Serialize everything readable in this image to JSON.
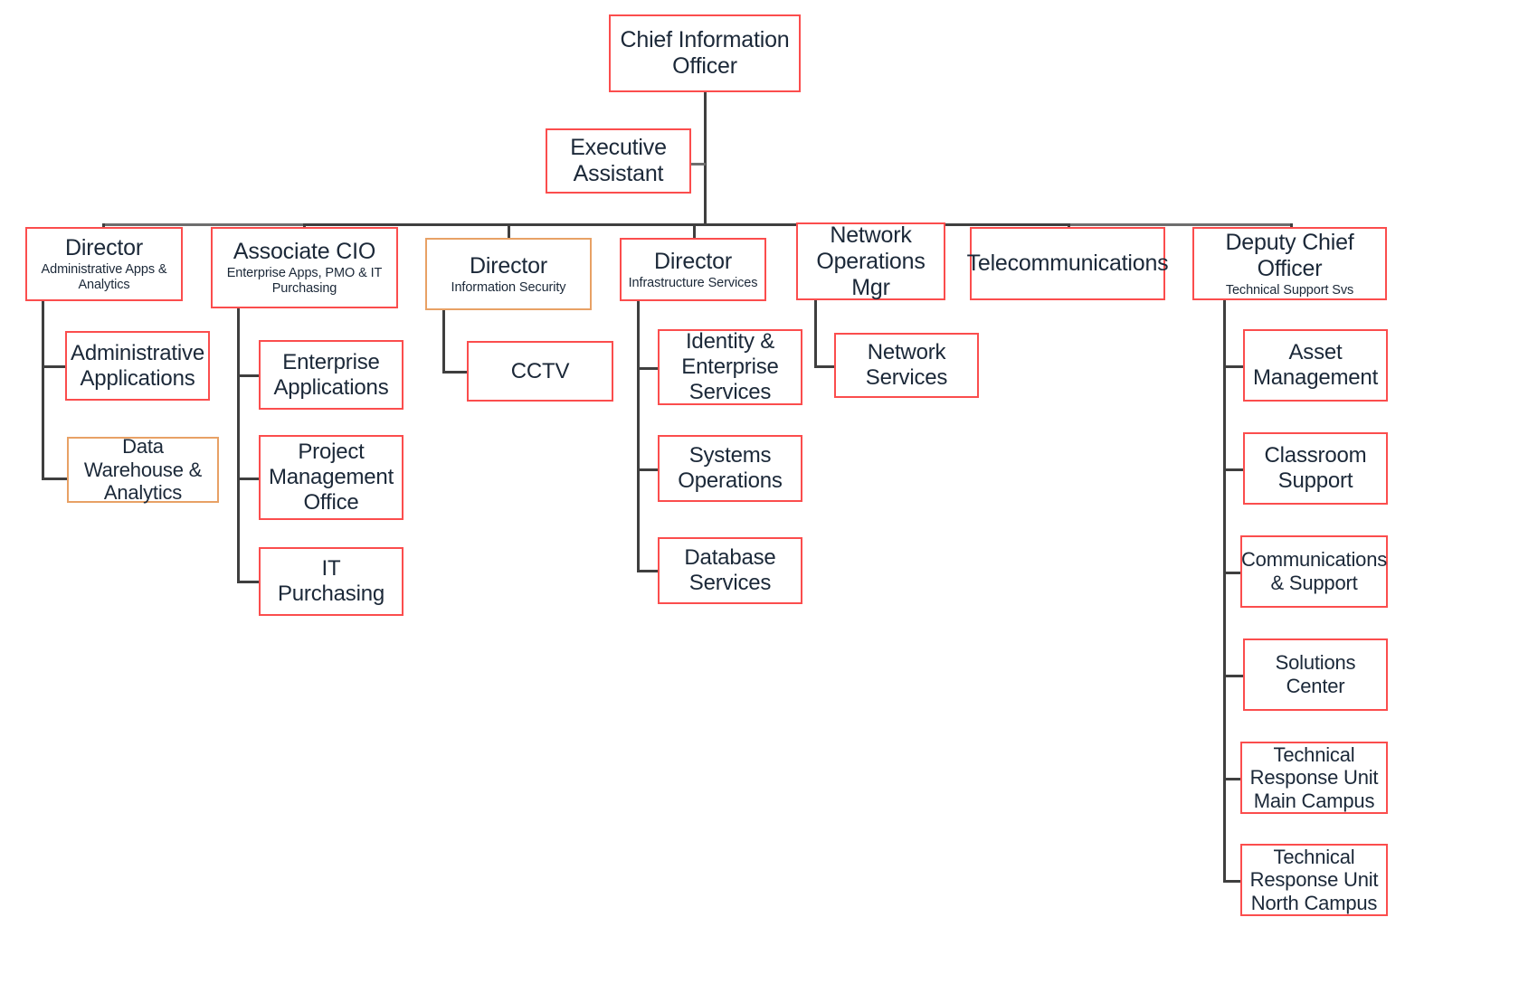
{
  "diagram": {
    "type": "organization-chart",
    "colors": {
      "node_border_primary": "#fb4d4d",
      "node_border_secondary": "#e8a165",
      "connector": "#3f3f3f",
      "background": "#ffffff",
      "text": "#1b2838"
    }
  },
  "nodes": {
    "cio": {
      "title": "Chief Information Officer",
      "sub": ""
    },
    "exec_assistant": {
      "title": "Executive Assistant",
      "sub": ""
    },
    "dir_admin_apps": {
      "title": "Director",
      "sub": "Administrative Apps & Analytics"
    },
    "assoc_cio": {
      "title": "Associate CIO",
      "sub": "Enterprise Apps, PMO & IT Purchasing"
    },
    "dir_info_sec": {
      "title": "Director",
      "sub": "Information Security"
    },
    "dir_infra": {
      "title": "Director",
      "sub": "Infrastructure Services"
    },
    "net_ops_mgr": {
      "title": "Network Operations Mgr",
      "sub": ""
    },
    "telecom": {
      "title": "Telecommunications",
      "sub": ""
    },
    "deputy_chief": {
      "title": "Deputy Chief Officer",
      "sub": "Technical Support Svs"
    },
    "admin_applications": {
      "title": "Administrative Applications",
      "sub": ""
    },
    "data_warehouse": {
      "title": "Data Warehouse & Analytics",
      "sub": ""
    },
    "enterprise_applications": {
      "title": "Enterprise Applications",
      "sub": ""
    },
    "pmo": {
      "title": "Project Management Office",
      "sub": ""
    },
    "it_purchasing": {
      "title": "IT Purchasing",
      "sub": ""
    },
    "cctv": {
      "title": "CCTV",
      "sub": ""
    },
    "identity_enterprise": {
      "title": "Identity & Enterprise Services",
      "sub": ""
    },
    "systems_operations": {
      "title": "Systems Operations",
      "sub": ""
    },
    "database_services": {
      "title": "Database Services",
      "sub": ""
    },
    "network_services": {
      "title": "Network Services",
      "sub": ""
    },
    "asset_management": {
      "title": "Asset Management",
      "sub": ""
    },
    "classroom_support": {
      "title": "Classroom Support",
      "sub": ""
    },
    "communications_support": {
      "title": "Communications & Support",
      "sub": ""
    },
    "solutions_center": {
      "title": "Solutions Center",
      "sub": ""
    },
    "tru_main": {
      "title": "Technical Response Unit Main Campus",
      "sub": ""
    },
    "tru_north": {
      "title": "Technical Response Unit North Campus",
      "sub": ""
    }
  }
}
